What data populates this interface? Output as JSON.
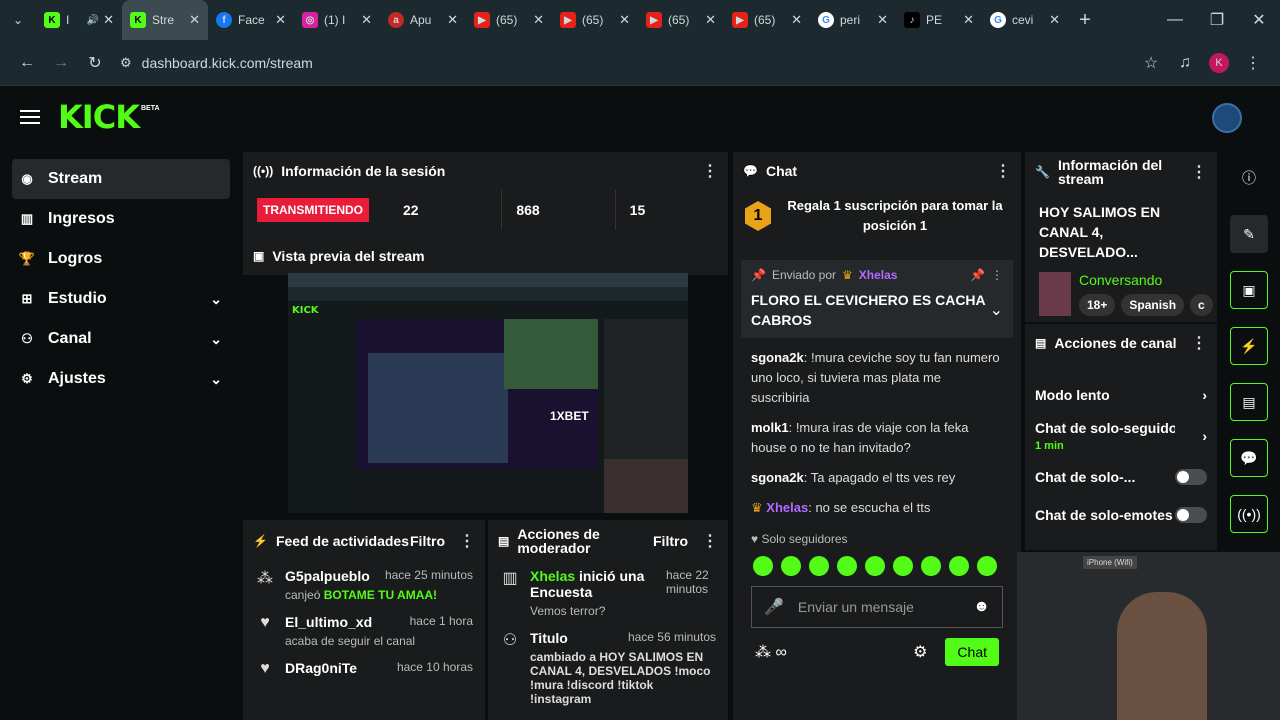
{
  "browser": {
    "tabs": [
      {
        "label": "I",
        "icon": "kick-icon",
        "active": false
      },
      {
        "label": "Stre",
        "icon": "kick-icon",
        "active": true
      },
      {
        "label": "Face",
        "icon": "facebook-icon",
        "active": false
      },
      {
        "label": "(1) I",
        "icon": "instagram-icon",
        "active": false
      },
      {
        "label": "Apu",
        "icon": "a-icon",
        "active": false
      },
      {
        "label": "(65)",
        "icon": "youtube-icon",
        "active": false
      },
      {
        "label": "(65)",
        "icon": "youtube-icon",
        "active": false
      },
      {
        "label": "(65)",
        "icon": "youtube-icon",
        "active": false
      },
      {
        "label": "(65)",
        "icon": "youtube-icon",
        "active": false
      },
      {
        "label": "peri",
        "icon": "google-icon",
        "active": false
      },
      {
        "label": "PE",
        "icon": "tiktok-icon",
        "active": false
      },
      {
        "label": "cevi",
        "icon": "google-icon",
        "active": false
      }
    ],
    "url": "dashboard.kick.com/stream",
    "profile_letter": "K"
  },
  "app": {
    "logo": "KICK",
    "beta": "BETA"
  },
  "sidebar": {
    "items": [
      {
        "label": "Stream",
        "active": true,
        "icon": "broadcast-icon"
      },
      {
        "label": "Ingresos",
        "active": false,
        "icon": "revenue-icon"
      },
      {
        "label": "Logros",
        "active": false,
        "icon": "trophy-icon"
      },
      {
        "label": "Estudio",
        "active": false,
        "icon": "studio-icon",
        "chevron": true
      },
      {
        "label": "Canal",
        "active": false,
        "icon": "channel-icon",
        "chevron": true
      },
      {
        "label": "Ajustes",
        "active": false,
        "icon": "gear-icon",
        "chevron": true
      }
    ]
  },
  "session": {
    "title": "Información de la sesión",
    "live_badge": "TRANSMITIENDO",
    "stats": [
      "22",
      "868",
      "15"
    ]
  },
  "preview": {
    "title": "Vista previa del stream"
  },
  "feed": {
    "title": "Feed de actividades",
    "filter": "Filtro",
    "items": [
      {
        "name": "G5palpueblo",
        "time": "hace 25 minutos",
        "sub_prefix": "canjeó ",
        "sub_highlight": "BOTAME TU AMAA!"
      },
      {
        "name": "El_ultimo_xd",
        "time": "hace 1 hora",
        "sub_prefix": "acaba de seguir el canal",
        "sub_highlight": ""
      },
      {
        "name": "DRag0niTe",
        "time": "hace 10 horas",
        "sub_prefix": "",
        "sub_highlight": ""
      }
    ]
  },
  "mod": {
    "title": "Acciones de moderador",
    "filter": "Filtro",
    "items": [
      {
        "name": "Xhelas",
        "action": " inició una Encuesta",
        "time": "hace 22 minutos",
        "detail": "Vemos terror?"
      },
      {
        "name": "Titulo",
        "action": "",
        "time": "hace 56 minutos",
        "detail": "cambiado a HOY SALIMOS EN CANAL 4, DESVELADOS !moco !mura !discord !tiktok !instagram"
      }
    ]
  },
  "chat": {
    "title": "Chat",
    "sub_promo": "Regala 1 suscripción para tomar la posición 1",
    "sub_rank": "1",
    "pinned_by": "Enviado por",
    "pinned_user": "Xhelas",
    "pinned_text": "FLORO EL CEVICHERO ES CACHA CABROS",
    "messages": [
      {
        "user": "sgona2k",
        "text": " !mura ceviche soy tu fan numero uno loco, si tuviera mas plata me suscribiria"
      },
      {
        "user": "molk1",
        "text": " !mura iras de viaje con la feka house o no te han invitado?"
      },
      {
        "user": "sgona2k",
        "text": " Ta apagado el tts ves rey"
      },
      {
        "user": "Xhelas",
        "text": " no se escucha el tts"
      }
    ],
    "followers_only": "Solo seguidores",
    "input_placeholder": "Enviar un mensaje",
    "send": "Chat"
  },
  "stream_info": {
    "title": "Información del stream",
    "stream_title": "HOY SALIMOS EN CANAL 4, DESVELADO...",
    "category": "Conversando",
    "tags": [
      "18+",
      "Spanish",
      "c"
    ]
  },
  "channel_actions": {
    "title": "Acciones de canal",
    "rows": [
      {
        "label": "Modo lento",
        "type": "chevron",
        "sub": ""
      },
      {
        "label": "Chat de solo-seguidores",
        "type": "chevron",
        "sub": "1 min"
      },
      {
        "label": "Chat de solo-...",
        "type": "toggle",
        "sub": ""
      },
      {
        "label": "Chat de solo-emotes",
        "type": "toggle",
        "sub": ""
      }
    ]
  },
  "webcam": {
    "label": "iPhone (Wifi)"
  },
  "colors": {
    "accent": "#53fc18",
    "live": "#e91c3a",
    "panel": "#191b1c",
    "bg": "#0b0e0f"
  }
}
